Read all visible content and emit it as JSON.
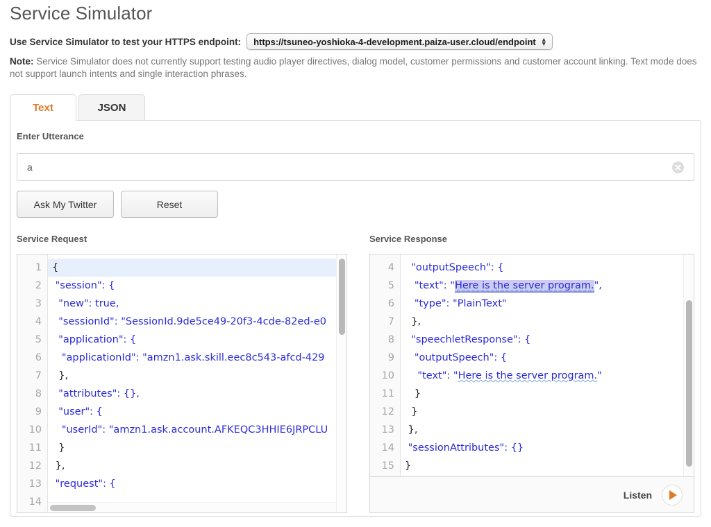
{
  "header": {
    "title": "Service Simulator",
    "endpoint_label": "Use Service Simulator to test your HTTPS endpoint:",
    "endpoint_value": "https://tsuneo-yoshioka-4-development.paiza-user.cloud/endpoint",
    "note_prefix": "Note:",
    "note_text": " Service Simulator does not currently support testing audio player directives, dialog model, customer permissions and customer account linking. Text mode does not support launch intents and single interaction phrases."
  },
  "tabs": [
    {
      "label": "Text",
      "active": true
    },
    {
      "label": "JSON",
      "active": false
    }
  ],
  "utterance": {
    "label": "Enter Utterance",
    "value": "a",
    "placeholder": "",
    "clear_icon": "clear-circle-icon"
  },
  "buttons": {
    "ask": "Ask My Twitter",
    "reset": "Reset"
  },
  "request": {
    "label": "Service Request",
    "first_line_number": 1,
    "active_line": 1,
    "lines": [
      {
        "n": 1,
        "text": "{"
      },
      {
        "n": 2,
        "text": " \"session\": {"
      },
      {
        "n": 3,
        "text": "  \"new\": true,"
      },
      {
        "n": 4,
        "text": "  \"sessionId\": \"SessionId.9de5ce49-20f3-4cde-82ed-e0"
      },
      {
        "n": 5,
        "text": "  \"application\": {"
      },
      {
        "n": 6,
        "text": "   \"applicationId\": \"amzn1.ask.skill.eec8c543-afcd-429"
      },
      {
        "n": 7,
        "text": "  },"
      },
      {
        "n": 8,
        "text": "  \"attributes\": {},"
      },
      {
        "n": 9,
        "text": "  \"user\": {"
      },
      {
        "n": 10,
        "text": "   \"userId\": \"amzn1.ask.account.AFKEQC3HHIE6JRPCLU"
      },
      {
        "n": 11,
        "text": "  }"
      },
      {
        "n": 12,
        "text": " },"
      },
      {
        "n": 13,
        "text": " \"request\": {"
      },
      {
        "n": 14,
        "text": ""
      }
    ]
  },
  "response": {
    "label": "Service Response",
    "first_line_number": 4,
    "selection_text": "Here is the server program.",
    "lines": [
      {
        "n": 4,
        "text": "  \"outputSpeech\": {"
      },
      {
        "n": 5,
        "text": "   \"text\": \"Here is the server program.\",",
        "selected": true
      },
      {
        "n": 6,
        "text": "   \"type\": \"PlainText\""
      },
      {
        "n": 7,
        "text": "  },"
      },
      {
        "n": 8,
        "text": "  \"speechletResponse\": {"
      },
      {
        "n": 9,
        "text": "   \"outputSpeech\": {"
      },
      {
        "n": 10,
        "text": "    \"text\": \"Here is the server program.\"",
        "spell": true
      },
      {
        "n": 11,
        "text": "   }"
      },
      {
        "n": 12,
        "text": "  }"
      },
      {
        "n": 13,
        "text": " },"
      },
      {
        "n": 14,
        "text": " \"sessionAttributes\": {}"
      },
      {
        "n": 15,
        "text": "}"
      }
    ]
  },
  "listen": {
    "label": "Listen",
    "play_icon": "play-triangle-icon"
  },
  "colors": {
    "accent_orange": "#e07b26",
    "code_blue": "#2b2bd8",
    "selection": "#ccccf2",
    "active_line": "#e6effb"
  }
}
